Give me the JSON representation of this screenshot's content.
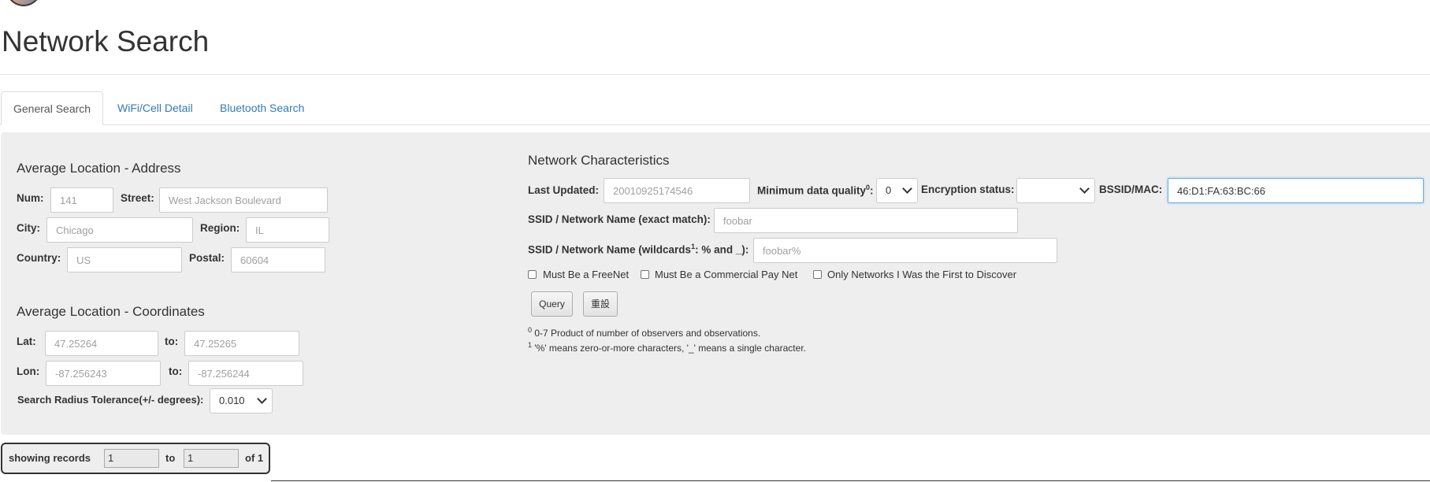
{
  "page_title": "Network Search",
  "tabs": [
    {
      "label": "General Search",
      "active": true
    },
    {
      "label": "WiFi/Cell Detail",
      "active": false
    },
    {
      "label": "Bluetooth Search",
      "active": false
    }
  ],
  "address": {
    "title": "Average Location - Address",
    "num_label": "Num:",
    "num_placeholder": "141",
    "street_label": "Street:",
    "street_placeholder": "West Jackson Boulevard",
    "city_label": "City:",
    "city_placeholder": "Chicago",
    "region_label": "Region:",
    "region_placeholder": "IL",
    "country_label": "Country:",
    "country_placeholder": "US",
    "postal_label": "Postal:",
    "postal_placeholder": "60604"
  },
  "coordinates": {
    "title": "Average Location - Coordinates",
    "lat_label": "Lat:",
    "lat_from_placeholder": "47.25264",
    "lat_to_label": "to:",
    "lat_to_placeholder": "47.25265",
    "lon_label": "Lon:",
    "lon_from_placeholder": "-87.256243",
    "lon_to_label": "to:",
    "lon_to_placeholder": "-87.256244",
    "radius_label": "Search Radius Tolerance(+/- degrees):",
    "radius_value": "0.010"
  },
  "network": {
    "title": "Network Characteristics",
    "last_updated_label": "Last Updated:",
    "last_updated_placeholder": "20010925174546",
    "min_quality_label": "Minimum data quality",
    "min_quality_sup": "0",
    "min_quality_colon": ":",
    "min_quality_value": "0",
    "encryption_label": "Encryption status:",
    "encryption_value": "",
    "bssid_label": "BSSID/MAC:",
    "bssid_value": "46:D1:FA:63:BC:66",
    "ssid_exact_label": "SSID / Network Name (exact match):",
    "ssid_exact_placeholder": "foobar",
    "ssid_wild_label_a": "SSID / Network Name (wildcards",
    "ssid_wild_sup": "1",
    "ssid_wild_label_b": ": % and _):",
    "ssid_wild_placeholder": "foobar%",
    "checkboxes": [
      {
        "label": "Must Be a FreeNet",
        "checked": false
      },
      {
        "label": "Must Be a Commercial Pay Net",
        "checked": false
      },
      {
        "label": "Only Networks I Was the First to Discover",
        "checked": false
      }
    ],
    "query_button": "Query",
    "reset_button": "重設",
    "note0_sup": "0",
    "note0_text": " 0-7 Product of number of observers and observations.",
    "note1_sup": "1",
    "note1_text": " '%' means zero-or-more characters, '_' means a single character."
  },
  "pager": {
    "showing_label": "showing records",
    "from_value": "1",
    "to_label": "to",
    "to_value": "1",
    "of_label": "of 1"
  }
}
